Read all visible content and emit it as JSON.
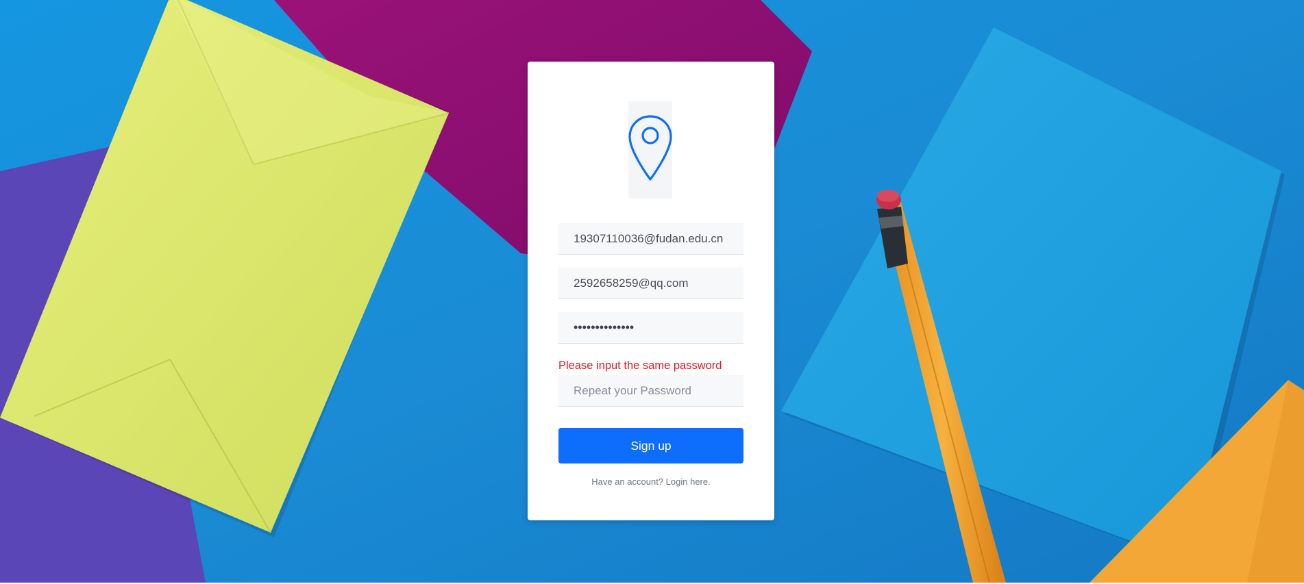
{
  "form": {
    "email_value": "19307110036@fudan.edu.cn",
    "secondary_email_value": "2592658259@qq.com",
    "password_value": "12345678901234",
    "error_message": "Please input the same password",
    "repeat_password_placeholder": "Repeat your Password",
    "repeat_password_value": "",
    "submit_label": "Sign up",
    "login_link_text": "Have an account? Login here."
  },
  "icons": {
    "logo": "map-pin-icon"
  },
  "colors": {
    "accent": "#0d6efd",
    "error": "#e8161f",
    "background_blue": "#1a8fd6"
  }
}
